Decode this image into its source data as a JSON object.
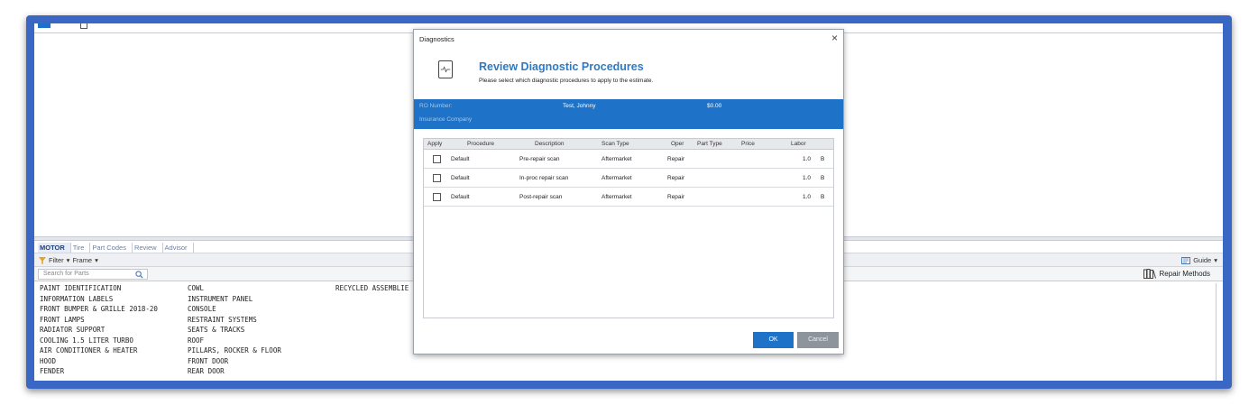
{
  "dialog": {
    "title": "Diagnostics",
    "close": "×",
    "heading": "Review Diagnostic Procedures",
    "subheading": "Please select which diagnostic procedures to apply to the estimate.",
    "ro_label": "RO Number:",
    "ro_name": "Test, Johnny",
    "ro_amount": "$0.00",
    "insurance_label": "Insurance Company",
    "columns": [
      "Apply",
      "Procedure",
      "Description",
      "Scan Type",
      "Oper",
      "Part Type",
      "Price",
      "Labor"
    ],
    "rows": [
      {
        "procedure": "Default",
        "description": "Pre-repair scan",
        "scan_type": "Aftermarket",
        "oper": "Repair",
        "labor": "1.0",
        "labor_type": "B"
      },
      {
        "procedure": "Default",
        "description": "In-proc repair scan",
        "scan_type": "Aftermarket",
        "oper": "Repair",
        "labor": "1.0",
        "labor_type": "B"
      },
      {
        "procedure": "Default",
        "description": "Post-repair scan",
        "scan_type": "Aftermarket",
        "oper": "Repair",
        "labor": "1.0",
        "labor_type": "B"
      }
    ],
    "ok": "OK",
    "cancel": "Cancel"
  },
  "tabs": [
    "MOTOR",
    "Tire",
    "Part Codes",
    "Review",
    "Advisor"
  ],
  "toolbar": {
    "filter": "Filter",
    "frame": "Frame",
    "guide": "Guide",
    "repair_methods": "Repair Methods"
  },
  "search": {
    "placeholder": "Search for Parts"
  },
  "parts": {
    "col1": [
      "PAINT IDENTIFICATION",
      "INFORMATION LABELS",
      "FRONT BUMPER & GRILLE 2018-20",
      "FRONT LAMPS",
      "RADIATOR SUPPORT",
      "COOLING 1.5 LITER TURBO",
      "AIR CONDITIONER & HEATER",
      "HOOD",
      "FENDER"
    ],
    "col2": [
      "COWL",
      "INSTRUMENT PANEL",
      "CONSOLE",
      "RESTRAINT SYSTEMS",
      "SEATS & TRACKS",
      "ROOF",
      "PILLARS, ROCKER & FLOOR",
      "FRONT DOOR",
      "REAR DOOR"
    ],
    "col3": [
      "RECYCLED ASSEMBLIE"
    ]
  },
  "colors": {
    "frame": "#3a67c4",
    "accent": "#1e72c8",
    "heading": "#2f7ac1"
  }
}
